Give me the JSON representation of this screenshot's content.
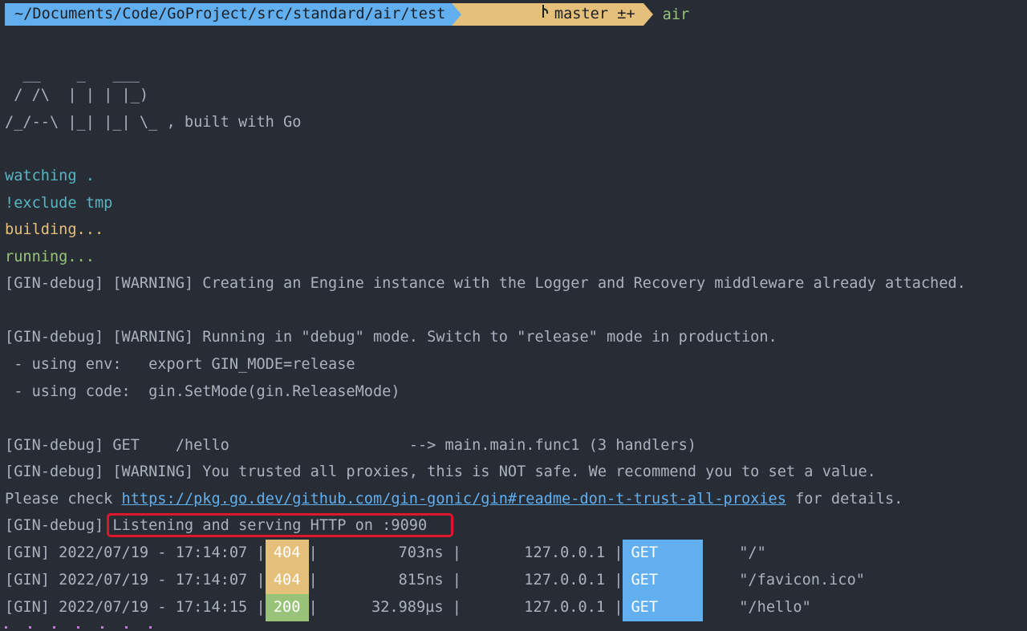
{
  "prompt": {
    "path": "~/Documents/Code/GoProject/src/standard/air/test",
    "branch_icon": "git-branch-icon",
    "branch": "master ±+",
    "command": "air"
  },
  "banner": {
    "line1": "  __    _   ___",
    "line2": " / /\\  | | | |_)",
    "line3": "/_/--\\ |_| |_| \\_ , built with Go"
  },
  "status_lines": {
    "watching": "watching .",
    "exclude": "!exclude tmp",
    "building": "building...",
    "running": "running..."
  },
  "log": {
    "warn_engine": "[GIN-debug] [WARNING] Creating an Engine instance with the Logger and Recovery middleware already attached.",
    "warn_debug": "[GIN-debug] [WARNING] Running in \"debug\" mode. Switch to \"release\" mode in production.",
    "using_env": " - using env:   export GIN_MODE=release",
    "using_code": " - using code:  gin.SetMode(gin.ReleaseMode)",
    "route": "[GIN-debug] GET    /hello                    --> main.main.func1 (3 handlers)",
    "warn_proxies": "[GIN-debug] [WARNING] You trusted all proxies, this is NOT safe. We recommend you to set a value.",
    "please_check": "Please check ",
    "proxies_link": "https://pkg.go.dev/github.com/gin-gonic/gin#readme-don-t-trust-all-proxies",
    "for_details": " for details.",
    "listen_prefix": "[GIN-debug] ",
    "listen_msg": "Listening and serving HTTP on :9090"
  },
  "requests": [
    {
      "prefix": "[GIN] 2022/07/19 - 17:14:07 |",
      "status": "404",
      "mid": "|         703ns |       127.0.0.1 |",
      "method": "GET",
      "path": "    \"/\""
    },
    {
      "prefix": "[GIN] 2022/07/19 - 17:14:07 |",
      "status": "404",
      "mid": "|         815ns |       127.0.0.1 |",
      "method": "GET",
      "path": "    \"/favicon.ico\""
    },
    {
      "prefix": "[GIN] 2022/07/19 - 17:14:15 |",
      "status": "200",
      "mid": "|      32.989µs |       127.0.0.1 |",
      "method": "GET",
      "path": "    \"/hello\""
    }
  ],
  "colors": {
    "background": "#282c34",
    "path_segment": "#61afef",
    "git_segment": "#e5c07b",
    "highlight_border": "#e0162b"
  }
}
